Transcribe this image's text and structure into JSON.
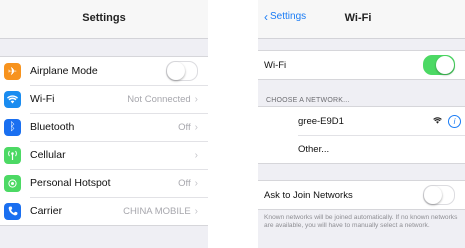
{
  "settings": {
    "title": "Settings",
    "items": [
      {
        "label": "Airplane Mode",
        "icon": "airplane-icon",
        "color": "#f7931e",
        "toggle": false
      },
      {
        "label": "Wi-Fi",
        "icon": "wifi-icon",
        "color": "#1a8cf0",
        "value": "Not Connected"
      },
      {
        "label": "Bluetooth",
        "icon": "bluetooth-icon",
        "color": "#1a6ff0",
        "value": "Off"
      },
      {
        "label": "Cellular",
        "icon": "cellular-icon",
        "color": "#4cd964",
        "value": ""
      },
      {
        "label": "Personal Hotspot",
        "icon": "hotspot-icon",
        "color": "#4cd964",
        "value": "Off"
      },
      {
        "label": "Carrier",
        "icon": "phone-icon",
        "color": "#1a6ff0",
        "value": "CHINA MOBILE"
      }
    ]
  },
  "wifi": {
    "back_label": "Settings",
    "title": "Wi-Fi",
    "wifi_label": "Wi-Fi",
    "wifi_on": true,
    "choose_header": "CHOOSE A NETWORK...",
    "networks": [
      {
        "name": "gree-E9D1"
      },
      {
        "name": "Other..."
      }
    ],
    "ask_label": "Ask to Join Networks",
    "ask_on": false,
    "footer": "Known networks will be joined automatically. If no known networks are available, you will have to manually select a network."
  }
}
